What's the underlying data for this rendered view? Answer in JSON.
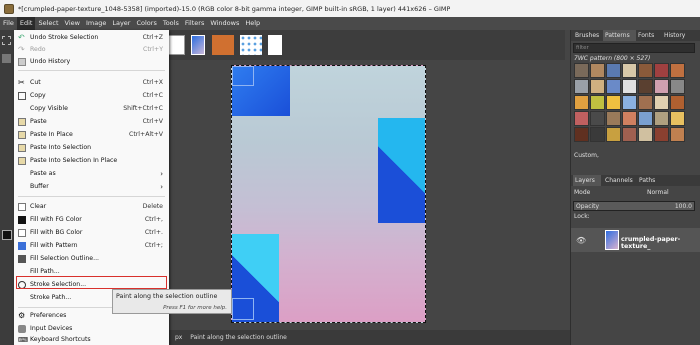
{
  "window": {
    "title": "*[crumpled-paper-texture_1048-5358] (imported)-15.0 (RGB color 8-bit gamma integer, GIMP built-in sRGB, 1 layer) 441x626 – GIMP"
  },
  "menubar": {
    "items": [
      "File",
      "Edit",
      "Select",
      "View",
      "Image",
      "Layer",
      "Colors",
      "Tools",
      "Filters",
      "Windows",
      "Help"
    ]
  },
  "edit_menu": {
    "items": [
      {
        "label": "Undo Stroke Selection",
        "shortcut": "Ctrl+Z",
        "icon": "undo-icon",
        "disabled": false
      },
      {
        "label": "Redo",
        "shortcut": "Ctrl+Y",
        "icon": "redo-icon",
        "disabled": true
      },
      {
        "label": "Undo History",
        "shortcut": "",
        "icon": "history-icon",
        "disabled": false
      },
      {
        "label": "Cut",
        "shortcut": "Ctrl+X",
        "icon": "scissors-icon",
        "disabled": false
      },
      {
        "label": "Copy",
        "shortcut": "Ctrl+C",
        "icon": "copy-icon",
        "disabled": false
      },
      {
        "label": "Copy Visible",
        "shortcut": "Shift+Ctrl+C",
        "icon": "",
        "disabled": false
      },
      {
        "label": "Paste",
        "shortcut": "Ctrl+V",
        "icon": "paste-icon",
        "disabled": false
      },
      {
        "label": "Paste In Place",
        "shortcut": "Ctrl+Alt+V",
        "icon": "paste-icon",
        "disabled": false
      },
      {
        "label": "Paste Into Selection",
        "shortcut": "",
        "icon": "paste-icon",
        "disabled": false
      },
      {
        "label": "Paste Into Selection In Place",
        "shortcut": "",
        "icon": "paste-icon",
        "disabled": false
      },
      {
        "label": "Paste as",
        "shortcut": "",
        "icon": "",
        "disabled": false,
        "submenu": true
      },
      {
        "label": "Buffer",
        "shortcut": "",
        "icon": "",
        "disabled": false,
        "submenu": true
      },
      {
        "label": "Clear",
        "shortcut": "Delete",
        "icon": "clear-icon",
        "disabled": false
      },
      {
        "label": "Fill with FG Color",
        "shortcut": "Ctrl+,",
        "icon": "fg-fill-icon",
        "disabled": false
      },
      {
        "label": "Fill with BG Color",
        "shortcut": "Ctrl+.",
        "icon": "bg-fill-icon",
        "disabled": false
      },
      {
        "label": "Fill with Pattern",
        "shortcut": "Ctrl+;",
        "icon": "pattern-fill-icon",
        "disabled": false
      },
      {
        "label": "Fill Selection Outline...",
        "shortcut": "",
        "icon": "fill-outline-icon",
        "disabled": false
      },
      {
        "label": "Fill Path...",
        "shortcut": "",
        "icon": "",
        "disabled": false
      },
      {
        "label": "Stroke Selection...",
        "shortcut": "",
        "icon": "stroke-selection-icon",
        "disabled": false
      },
      {
        "label": "Stroke Path...",
        "shortcut": "",
        "icon": "",
        "disabled": false
      },
      {
        "label": "Preferences",
        "shortcut": "",
        "icon": "preferences-icon",
        "disabled": false
      },
      {
        "label": "Input Devices",
        "shortcut": "",
        "icon": "input-devices-icon",
        "disabled": false
      },
      {
        "label": "Keyboard Shortcuts",
        "shortcut": "",
        "icon": "keyboard-icon",
        "disabled": false
      }
    ]
  },
  "tooltip": {
    "text": "Paint along the selection outline",
    "help": "Press F1 for more help."
  },
  "statusbar": {
    "unit": "px",
    "message": "Paint along the selection outline"
  },
  "right_panel": {
    "tabs": [
      "Brushes",
      "Patterns",
      "Fonts",
      "History"
    ],
    "filter_placeholder": "filter",
    "pattern_name": "7WC pattern (800 × 527)",
    "preset": "Custom,",
    "layer_tabs": [
      "Layers",
      "Channels",
      "Paths"
    ],
    "mode_label": "Mode",
    "mode_value": "Normal",
    "opacity_label": "Opacity",
    "opacity_value": "100.0",
    "lock_label": "Lock:",
    "layer_name": "crumpled-paper-texture_"
  },
  "colors": {
    "menu_bg": "#f9f9f9",
    "highlight": "#d8302c",
    "canvas_blue": "#1f5fe0",
    "canvas_cyan": "#29c2f0"
  }
}
